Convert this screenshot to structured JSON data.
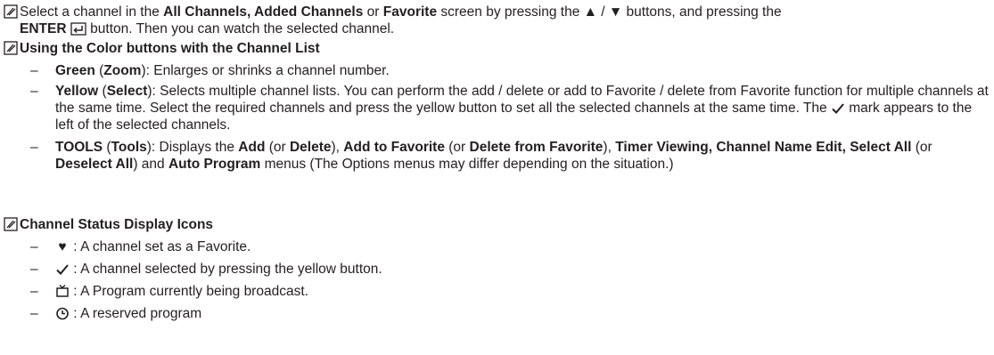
{
  "note1": {
    "p1": "Select a channel in the ",
    "b1": "All Channels, Added Channels",
    "p2": " or ",
    "b2": "Favorite",
    "p3": " screen by pressing the ▲ / ▼ buttons, and pressing the",
    "b3": "ENTER",
    "p4": " button. Then you can watch the selected channel."
  },
  "note2": {
    "heading": "Using the Color buttons with the Channel List",
    "green": {
      "dash": "–",
      "b1": "Green",
      "p1": " (",
      "b2": "Zoom",
      "p2": "): Enlarges or shrinks a channel number."
    },
    "yellow": {
      "dash": "–",
      "b1": "Yellow",
      "p1": " (",
      "b2": "Select",
      "p2": "): Selects multiple channel lists. You can perform the add / delete or add to Favorite / delete from Favorite function for multiple channels at the same time. Select the required channels and press the yellow button to set all the selected channels at the same time. The ",
      "p3": " mark appears to the left of the selected channels."
    },
    "tools": {
      "dash": "–",
      "b1": "TOOLS",
      "p1": " (",
      "b2": "Tools",
      "p2": "): Displays the ",
      "b3": "Add",
      "p3": " (or ",
      "b4": "Delete",
      "p4": "), ",
      "b5": "Add to Favorite",
      "p5": " (or ",
      "b6": "Delete from Favorite",
      "p6": "), ",
      "b7": "Timer Viewing, Channel Name Edit, Select All",
      "p7": " (or ",
      "b8": "Deselect All",
      "p8": ") and ",
      "b9": "Auto Program",
      "p9": " menus (The Options menus may differ depending on the situation.)"
    }
  },
  "note3": {
    "heading": "Channel Status Display Icons",
    "items": [
      {
        "dash": "–",
        "symbol": "♥",
        "text": " : A channel set as a Favorite."
      },
      {
        "dash": "–",
        "symbol_icon": "check-icon",
        "text": " : A channel selected by pressing the yellow button."
      },
      {
        "dash": "–",
        "symbol_icon": "tv-icon",
        "text": " : A Program currently being broadcast."
      },
      {
        "dash": "–",
        "symbol_icon": "clock-icon",
        "text": " : A reserved program"
      }
    ]
  }
}
